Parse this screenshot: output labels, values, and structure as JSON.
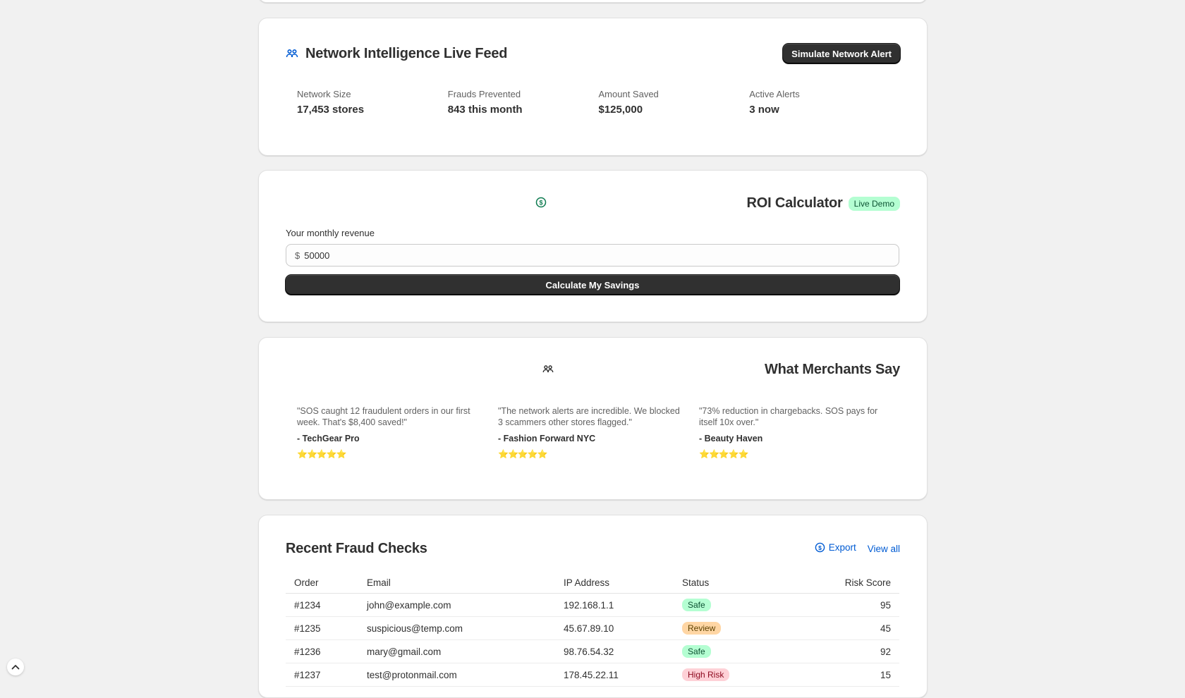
{
  "network": {
    "title": "Network Intelligence Live Feed",
    "simulate_button": "Simulate Network Alert",
    "stats": [
      {
        "label": "Network Size",
        "value": "17,453 stores"
      },
      {
        "label": "Frauds Prevented",
        "value": "843 this month"
      },
      {
        "label": "Amount Saved",
        "value": "$125,000"
      },
      {
        "label": "Active Alerts",
        "value": "3 now"
      }
    ]
  },
  "roi": {
    "title": "ROI Calculator",
    "badge": "Live Demo",
    "field_label": "Your monthly revenue",
    "currency_prefix": "$",
    "input_value": "50000",
    "calculate_button": "Calculate My Savings"
  },
  "testimonials": {
    "title": "What Merchants Say",
    "items": [
      {
        "quote": "\"SOS caught 12 fraudulent orders in our first week. That's $8,400 saved!\"",
        "author": "- TechGear Pro",
        "stars": "⭐⭐⭐⭐⭐"
      },
      {
        "quote": "\"The network alerts are incredible. We blocked 3 scammers other stores flagged.\"",
        "author": "- Fashion Forward NYC",
        "stars": "⭐⭐⭐⭐⭐"
      },
      {
        "quote": "\"73% reduction in chargebacks. SOS pays for itself 10x over.\"",
        "author": "- Beauty Haven",
        "stars": "⭐⭐⭐⭐⭐"
      }
    ]
  },
  "fraud_checks": {
    "title": "Recent Fraud Checks",
    "export_label": "Export",
    "view_all_label": "View all",
    "columns": [
      "Order",
      "Email",
      "IP Address",
      "Status",
      "Risk Score"
    ],
    "rows": [
      {
        "order": "#1234",
        "email": "john@example.com",
        "ip": "192.168.1.1",
        "status": "Safe",
        "score": "95"
      },
      {
        "order": "#1235",
        "email": "suspicious@temp.com",
        "ip": "45.67.89.10",
        "status": "Review",
        "score": "45"
      },
      {
        "order": "#1236",
        "email": "mary@gmail.com",
        "ip": "98.76.54.32",
        "status": "Safe",
        "score": "92"
      },
      {
        "order": "#1237",
        "email": "test@protonmail.com",
        "ip": "178.45.22.11",
        "status": "High Risk",
        "score": "15"
      }
    ]
  },
  "colors": {
    "safe_bg": "#b4fed2",
    "safe_fg": "#0c5132",
    "review_bg": "#ffd6a4",
    "review_fg": "#5e4200",
    "high_risk_bg": "#fed1d7",
    "high_risk_fg": "#8e0b21",
    "accent": "#005bd3"
  },
  "icons": {
    "network": "people-icon",
    "roi": "dollar-circle-icon",
    "testimonials": "people-icon",
    "export": "dollar-circle-icon",
    "scroll_top": "chevron-up-icon"
  }
}
